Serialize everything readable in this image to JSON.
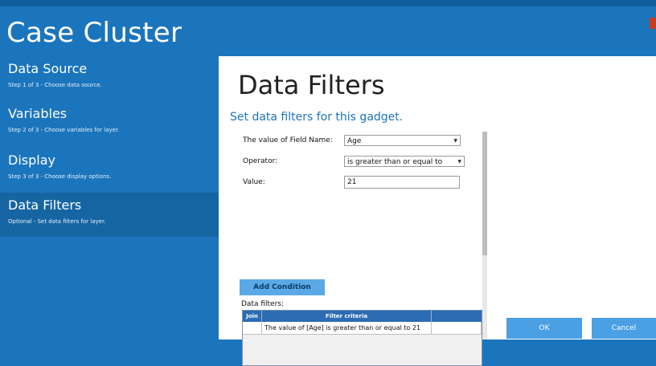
{
  "app": {
    "title": "Case Cluster"
  },
  "sidebar": {
    "items": [
      {
        "title": "Data Source",
        "desc": "Step 1 of 3 - Choose data source."
      },
      {
        "title": "Variables",
        "desc": "Step 2 of 3 - Choose variables for layer."
      },
      {
        "title": "Display",
        "desc": "Step 3 of 3 - Choose display options."
      },
      {
        "title": "Data Filters",
        "desc": "Optional - Set data filters for layer."
      }
    ],
    "active_index": 3
  },
  "main": {
    "title": "Data Filters",
    "subtitle": "Set data filters for this gadget.",
    "form": {
      "field_name_label": "The value of Field Name:",
      "field_name_value": "Age",
      "operator_label": "Operator:",
      "operator_value": "is greater than or equal to",
      "value_label": "Value:",
      "value_value": "21"
    },
    "add_condition_label": "Add Condition",
    "filters_label": "Data filters:",
    "table": {
      "headers": [
        "Join",
        "Filter criteria",
        ""
      ],
      "rows": [
        [
          "",
          "The value of [Age] is greater than or equal to 21",
          ""
        ]
      ]
    }
  },
  "buttons": {
    "ok": "OK",
    "cancel": "Cancel"
  },
  "colors": {
    "sidebar_bg": "#1b75bc",
    "active_item": "#1665a3",
    "accent": "#4aa0e2"
  }
}
